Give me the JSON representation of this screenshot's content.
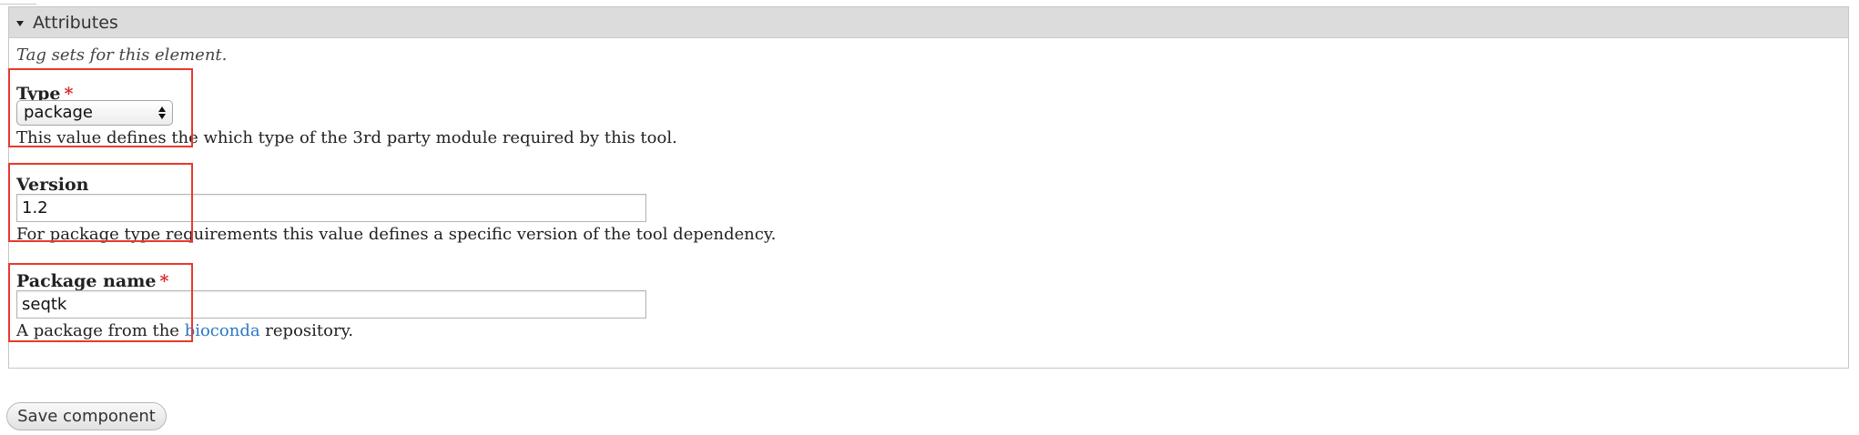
{
  "fieldset": {
    "legend": "Attributes",
    "description": "Tag sets for this element."
  },
  "type_field": {
    "label": "Type",
    "required_marker": "*",
    "selected": "package",
    "help": "This value defines the which type of the 3rd party module required by this tool."
  },
  "version_field": {
    "label": "Version",
    "value": "1.2",
    "help": "For package type requirements this value defines a specific version of the tool dependency."
  },
  "package_field": {
    "label": "Package name",
    "required_marker": "*",
    "value": "seqtk",
    "help_before": "A package from the ",
    "help_link": "bioconda",
    "help_after": " repository."
  },
  "actions": {
    "save_label": "Save component"
  },
  "colors": {
    "required": "#d9272a",
    "link": "#2a78c4",
    "highlight_box": "#e53a2f",
    "legend_bg": "#dcdcdc"
  }
}
